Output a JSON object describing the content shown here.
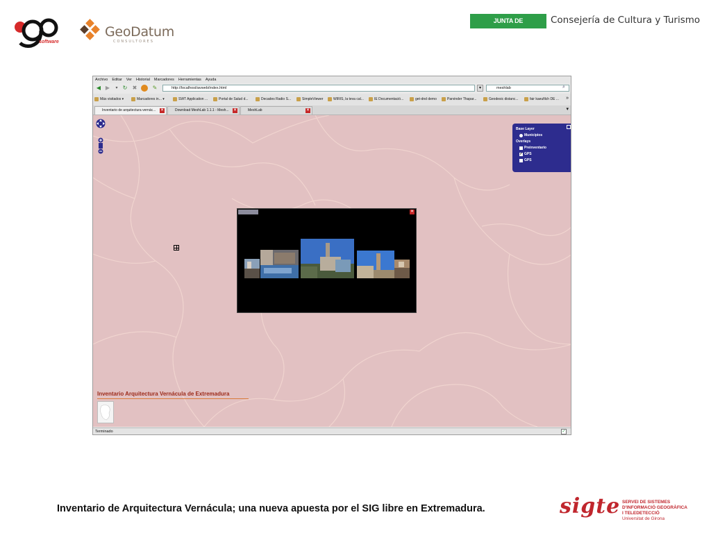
{
  "slide": {
    "logos": {
      "go_software": "software",
      "geodatum": "GeoDatum",
      "geodatum_sub": "CONSULTORES",
      "junta": "JUNTA DE EXTREMADURA",
      "consejeria": "Consejería de Cultura y Turismo"
    },
    "caption": "Inventario de Arquitectura Vernácula; una nueva apuesta por el SIG libre en Extremadura.",
    "sigte": {
      "word": "sigte",
      "line1": "SERVEI DE SISTEMES",
      "line2": "D'INFORMACIÓ GEOGRÀFICA",
      "line3": "I TELEDETECCIÓ",
      "line4": "Universitat de Girona"
    }
  },
  "browser": {
    "menu": [
      "Archivo",
      "Editar",
      "Ver",
      "Historial",
      "Marcadores",
      "Herramientas",
      "Ayuda"
    ],
    "url": "http://localhost/avweb/index.html",
    "search": "meshlab",
    "bookmarks": [
      "Más visitados ▾",
      "Marcadores in... ▾",
      "SWT Application ...",
      "Portal de Salud d...",
      "Decades Radio S...",
      "SimpleViewer",
      "WIRIS, la teva cal...",
      "IE Documentació...",
      "get-dnd demo",
      "Parvinder Thapar...",
      "Geodesic distanc...",
      "fair kaeufilch DE ..."
    ],
    "bookmarks_more": "»",
    "tabs": [
      {
        "label": "Inventario de arquitectura vernác...",
        "active": true
      },
      {
        "label": "Download MeshLab 1.1.1 - Mesh...",
        "active": false
      },
      {
        "label": "MeshLab",
        "active": false
      }
    ],
    "status": "Terminado",
    "map": {
      "layer_switcher": {
        "base_title": "Base Layer",
        "base_items": [
          "Municipios"
        ],
        "overlays_title": "Overlays",
        "overlay_items": [
          {
            "label": "Preinventario",
            "checked": false
          },
          {
            "label": "GPS",
            "checked": true
          },
          {
            "label": "GPS",
            "checked": false
          }
        ]
      },
      "title": "Inventario Arquitectura Vernácula de Extremadura"
    }
  },
  "colors": {
    "map_bg": "#e2c1c2",
    "layer_panel": "#2d2c8e",
    "junta_green": "#2e9e48",
    "sigte_red": "#c0262d",
    "map_title": "#9c2a1a"
  }
}
